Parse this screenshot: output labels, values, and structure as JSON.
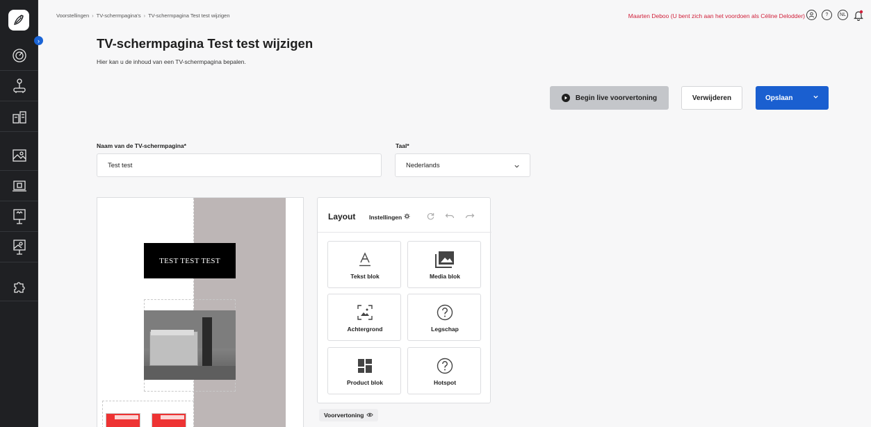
{
  "breadcrumb": [
    "Voorstellingen",
    "TV-schermpagina's",
    "TV-schermpagina Test test wijzigen"
  ],
  "header": {
    "impersonation": "Maarten Deboo (U bent zich aan het voordoen als Céline Delodder)",
    "language_badge": "NL",
    "help_icon": "?"
  },
  "page": {
    "title": "TV-schermpagina Test test wijzigen",
    "subtitle": "Hier kan u de inhoud van een TV-schermpagina bepalen."
  },
  "actions": {
    "preview": "Begin live voorvertoning",
    "delete": "Verwijderen",
    "save": "Opslaan"
  },
  "form": {
    "name_label": "Naam van de TV-schermpagina*",
    "name_value": "Test test",
    "language_label": "Taal*",
    "language_value": "Nederlands"
  },
  "canvas": {
    "text_block": "TEST TEST TEST"
  },
  "layout_panel": {
    "title": "Layout",
    "settings": "Instellingen",
    "tiles": [
      "Tekst blok",
      "Media blok",
      "Achtergrond",
      "Legschap",
      "Product blok",
      "Hotspot"
    ]
  },
  "preview_toggle": "Voorvertoning",
  "colors": {
    "sidebar": "#1f2023",
    "primary": "#1a5fd0",
    "alert": "#d0203a",
    "preview_button": "#c4c6ca"
  },
  "sidebar_icons": [
    "dashboard-icon",
    "joystick-icon",
    "products-icon",
    "image-icon",
    "screen-icon",
    "presentation-icon",
    "display-stand-icon",
    "puzzle-icon"
  ]
}
